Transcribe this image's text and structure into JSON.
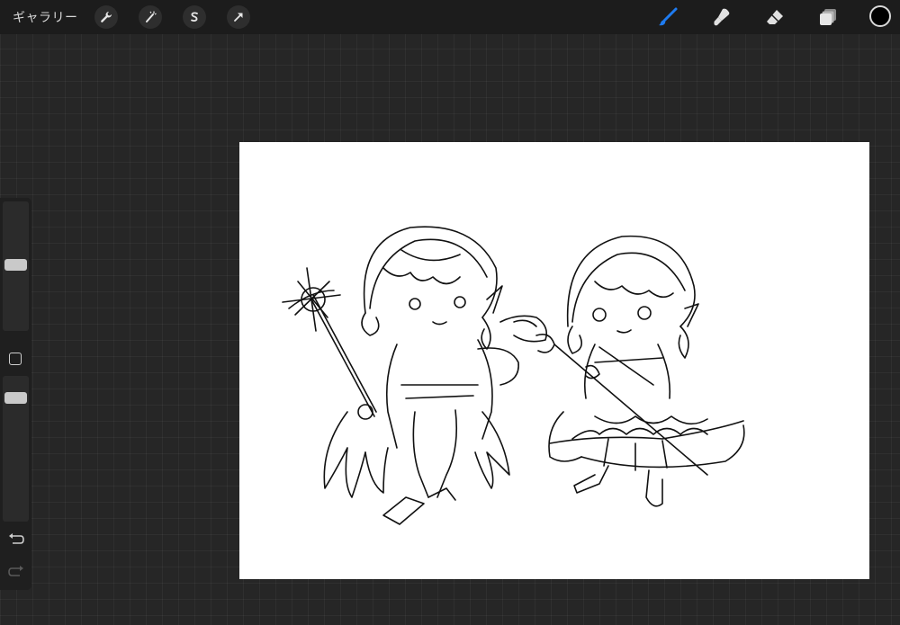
{
  "topbar": {
    "gallery_label": "ギャラリー",
    "left_tools": [
      "wrench-icon",
      "magic-wand-icon",
      "selection-icon",
      "transform-arrow-icon"
    ],
    "right_tools": [
      "brush-icon",
      "smudge-icon",
      "eraser-icon",
      "layers-icon"
    ],
    "active_tool": "brush-icon",
    "accent_color": "#1e7bf0",
    "current_color": "#000000"
  },
  "sidebar": {
    "brush_size_level": 0.5,
    "opacity_level": 0.5,
    "controls": [
      "brush-size-slider",
      "modify-button",
      "opacity-slider",
      "undo-button",
      "redo-button"
    ]
  },
  "canvas": {
    "background": "#ffffff",
    "content": "line-art-sketch"
  }
}
